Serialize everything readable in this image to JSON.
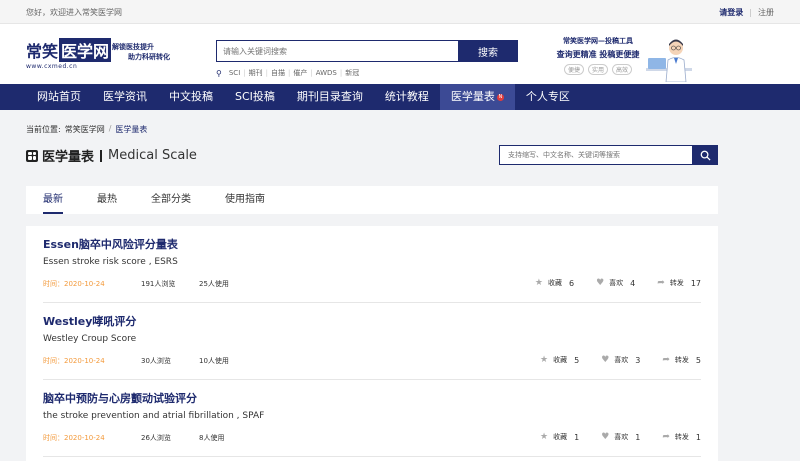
{
  "topbar": {
    "welcome": "您好，欢迎进入常笑医学网",
    "login": "请登录",
    "register": "注册",
    "sep": "|"
  },
  "logo": {
    "name_part1": "常笑",
    "name_part2": "医学网",
    "url": "www.cxmed.cn"
  },
  "slogan": {
    "line1": "解锁医技提升",
    "line2": "助力科研转化"
  },
  "search": {
    "placeholder": "请输入关键词搜索",
    "button": "搜索",
    "quick_links": [
      "SCI",
      "期刊",
      "自描",
      "催产",
      "AWDS",
      "新冠"
    ]
  },
  "promo": {
    "line1": "常笑医学网—投稿工具",
    "line2": "查询更精准 投稿更便捷",
    "tags": [
      "便捷",
      "实用",
      "高效"
    ]
  },
  "nav": {
    "items": [
      "网站首页",
      "医学资讯",
      "中文投稿",
      "SCI投稿",
      "期刊目录查询",
      "统计教程",
      "医学量表",
      "个人专区"
    ],
    "active_index": 6,
    "badge": "N"
  },
  "breadcrumb": {
    "label": "当前位置:",
    "home": "常笑医学网",
    "sep": "/",
    "current": "医学量表"
  },
  "page": {
    "title": "医学量表",
    "subtitle": "Medical Scale"
  },
  "scale_search": {
    "placeholder": "支持缩写、中文名称、关键词等搜索"
  },
  "tabs": [
    "最新",
    "最热",
    "全部分类",
    "使用指南"
  ],
  "actions": {
    "collect": "收藏",
    "like": "喜欢",
    "share": "转发"
  },
  "items": [
    {
      "title": "Essen脑卒中风险评分量表",
      "en": "Essen stroke risk score , ESRS",
      "date": "时间：2020-10-24",
      "views": "191人浏览",
      "uses": "25人使用",
      "collect": "6",
      "like": "4",
      "share": "17"
    },
    {
      "title": "Westley哮吼评分",
      "en": "Westley Croup Score",
      "date": "时间：2020-10-24",
      "views": "30人浏览",
      "uses": "10人使用",
      "collect": "5",
      "like": "3",
      "share": "5"
    },
    {
      "title": "脑卒中预防与心房颤动试验评分",
      "en": "the stroke prevention and atrial fibrillation , SPAF",
      "date": "时间：2020-10-24",
      "views": "26人浏览",
      "uses": "8人使用",
      "collect": "1",
      "like": "1",
      "share": "1"
    }
  ]
}
